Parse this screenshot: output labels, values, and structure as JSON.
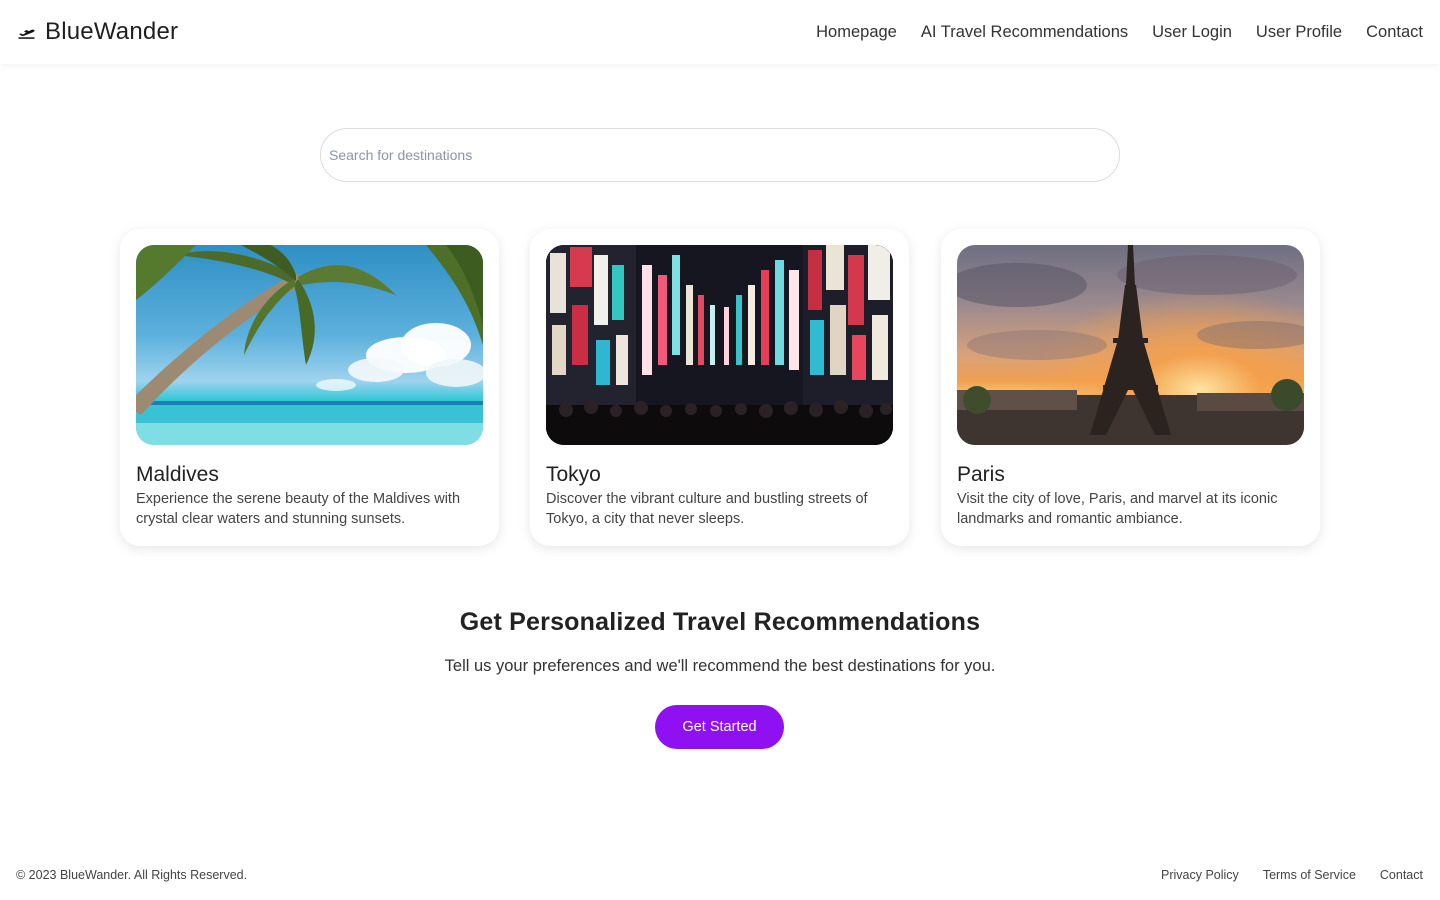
{
  "header": {
    "brand_icon": "airplane-takeoff-icon",
    "brand_name": "BlueWander",
    "nav": [
      "Homepage",
      "AI Travel Recommendations",
      "User Login",
      "User Profile",
      "Contact"
    ]
  },
  "search": {
    "placeholder": "Search for destinations",
    "value": ""
  },
  "destinations": [
    {
      "title": "Maldives",
      "description": "Experience the serene beauty of the Maldives with crystal clear waters and stunning sunsets.",
      "image": "beach-palm-tree-photo"
    },
    {
      "title": "Tokyo",
      "description": "Discover the vibrant culture and bustling streets of Tokyo, a city that never sleeps.",
      "image": "neon-street-night-photo"
    },
    {
      "title": "Paris",
      "description": "Visit the city of love, Paris, and marvel at its iconic landmarks and romantic ambiance.",
      "image": "eiffel-tower-sunset-photo"
    }
  ],
  "cta": {
    "title": "Get Personalized Travel Recommendations",
    "subtitle": "Tell us your preferences and we'll recommend the best destinations for you.",
    "button_label": "Get Started"
  },
  "footer": {
    "copyright": "© 2023 BlueWander. All Rights Reserved.",
    "links": [
      "Privacy Policy",
      "Terms of Service",
      "Contact"
    ]
  },
  "colors": {
    "accent": "#8f10f0",
    "text": "#222222",
    "background": "#ffffff"
  }
}
